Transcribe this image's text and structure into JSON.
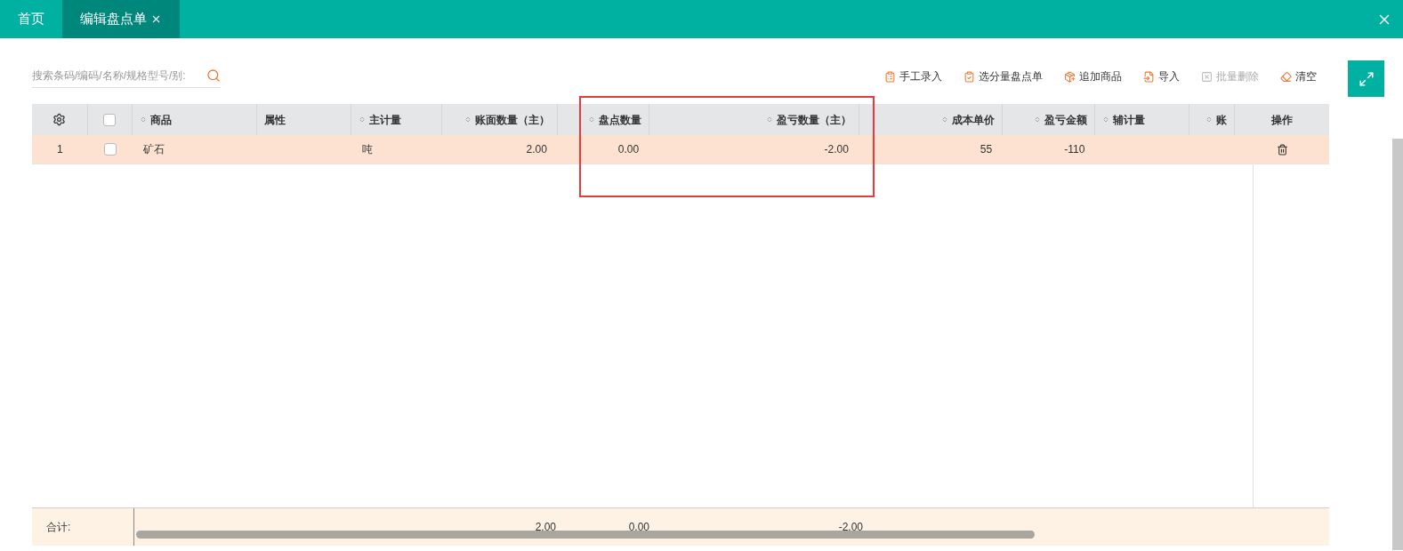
{
  "tabs": [
    {
      "label": "首页",
      "selected": false,
      "closable": false
    },
    {
      "label": "编辑盘点单",
      "selected": true,
      "closable": true
    }
  ],
  "search": {
    "placeholder": "搜索条码/编码/名称/规格型号/别:"
  },
  "toolbar": [
    {
      "label": "手工录入",
      "kind": "manual",
      "disabled": false
    },
    {
      "label": "选分量盘点单",
      "kind": "select",
      "disabled": false
    },
    {
      "label": "追加商品",
      "kind": "add",
      "disabled": false
    },
    {
      "label": "导入",
      "kind": "import",
      "disabled": false
    },
    {
      "label": "批量删除",
      "kind": "delete",
      "disabled": true
    },
    {
      "label": "清空",
      "kind": "clear",
      "disabled": false
    }
  ],
  "table": {
    "all_checked": false,
    "columns": [
      {
        "label": "商品",
        "sortable": true
      },
      {
        "label": "属性",
        "sortable": false
      },
      {
        "label": "主计量",
        "sortable": true
      },
      {
        "label": "账面数量（主）",
        "sortable": true
      },
      {
        "label": "盘点数量",
        "sortable": true
      },
      {
        "label": "盈亏数量（主）",
        "sortable": true
      },
      {
        "label": "成本单价",
        "sortable": true
      },
      {
        "label": "盈亏金额",
        "sortable": true
      },
      {
        "label": "辅计量",
        "sortable": true
      },
      {
        "label": "账",
        "sortable": true
      }
    ],
    "action_column": "操作",
    "rows": [
      {
        "index": "1",
        "checked": false,
        "cells": [
          "矿石",
          "",
          "吨",
          "2.00",
          "0.00",
          "-2.00",
          "55",
          "-110",
          "",
          ""
        ]
      }
    ],
    "footer": {
      "label": "合计:",
      "cells": [
        "",
        "",
        "",
        "2.00",
        "0.00",
        "-2.00",
        "",
        "",
        "",
        ""
      ]
    }
  }
}
